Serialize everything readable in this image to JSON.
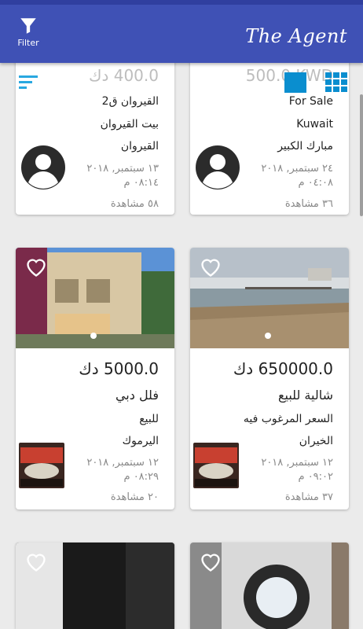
{
  "app": {
    "title": "The Agent",
    "filter_label": "Filter"
  },
  "listings": [
    {
      "price": "500.0 KWD",
      "line1": "For Sale",
      "line2": "Kuwait",
      "line3": "مبارك الكبير",
      "date_line1": "٢٤ سبتمبر, ٢٠١٨",
      "date_line2": "٠٤:٠٨ م",
      "views": "٣٦ مشاهدة",
      "thumb": "avatar-icon"
    },
    {
      "price": "400.0 دك",
      "line1": "القيروان ق2",
      "line2": "بيت القيروان",
      "line3": "القيروان",
      "date_line1": "١٣ سبتمبر, ٢٠١٨",
      "date_line2": "٠٨:١٤ م",
      "views": "٥٨ مشاهدة",
      "thumb": "avatar-icon"
    },
    {
      "price": "650000.0 دك",
      "line1": "شالية للبيع",
      "line2": "السعر المرغوب فيه",
      "line3": "الخيران",
      "date_line1": "١٢ سبتمبر, ٢٠١٨",
      "date_line2": "٠٩:٠٢ م",
      "views": "٣٧ مشاهدة",
      "photo": "beach",
      "thumb": "agency-logo"
    },
    {
      "price": "5000.0 دك",
      "line1": "فلل دبي",
      "line2": "للبيع",
      "line3": "اليرموك",
      "date_line1": "١٢ سبتمبر, ٢٠١٨",
      "date_line2": "٠٨:٢٩ م",
      "views": "٢٠ مشاهدة",
      "photo": "villa",
      "thumb": "agency-logo"
    }
  ]
}
